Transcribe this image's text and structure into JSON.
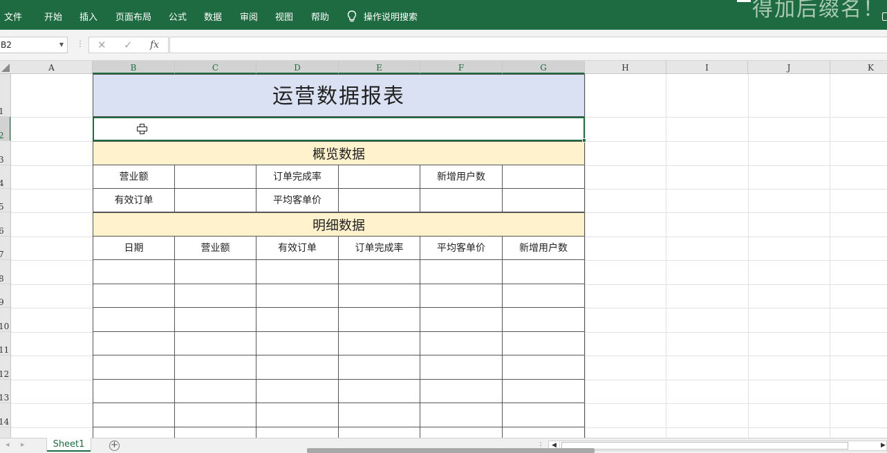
{
  "ribbon": {
    "tabs": [
      "文件",
      "开始",
      "插入",
      "页面布局",
      "公式",
      "数据",
      "审阅",
      "视图",
      "帮助"
    ],
    "search_label": "操作说明搜索",
    "watermark": "得加后缀名！"
  },
  "formula_bar": {
    "name_box": "B2",
    "formula": ""
  },
  "columns": [
    "A",
    "B",
    "C",
    "D",
    "E",
    "F",
    "G",
    "H",
    "I",
    "J",
    "K"
  ],
  "rows": [
    "1",
    "2",
    "3",
    "4",
    "5",
    "6",
    "7",
    "8",
    "9",
    "10",
    "11",
    "12",
    "13",
    "14"
  ],
  "report": {
    "title": "运营数据报表",
    "overview_title": "概览数据",
    "overview_row1": [
      "营业额",
      "",
      "订单完成率",
      "",
      "新增用户数",
      ""
    ],
    "overview_row2": [
      "有效订单",
      "",
      "平均客单价",
      "",
      "",
      ""
    ],
    "detail_title": "明细数据",
    "detail_headers": [
      "日期",
      "营业额",
      "有效订单",
      "订单完成率",
      "平均客单价",
      "新增用户数"
    ]
  },
  "sheets": {
    "active": "Sheet1"
  },
  "colors": {
    "ribbon": "#1e6b41",
    "title_fill": "#d9e1f2",
    "section_fill": "#fff2cc"
  }
}
